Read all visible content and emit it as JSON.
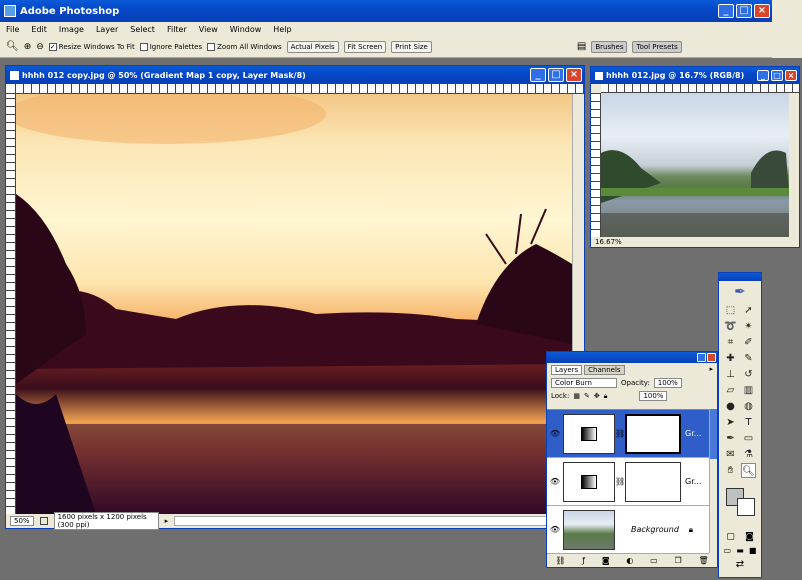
{
  "app": {
    "title": "Adobe Photoshop"
  },
  "menu": [
    "File",
    "Edit",
    "Image",
    "Layer",
    "Select",
    "Filter",
    "View",
    "Window",
    "Help"
  ],
  "options": {
    "resize_windows": "Resize Windows To Fit",
    "ignore_palettes": "Ignore Palettes",
    "zoom_all": "Zoom All Windows",
    "actual_pixels": "Actual Pixels",
    "fit_screen": "Fit Screen",
    "print_size": "Print Size",
    "well_tab1": "Brushes",
    "well_tab2": "Tool Presets"
  },
  "doc1": {
    "title": "hhhh 012 copy.jpg @ 50% (Gradient Map 1 copy, Layer Mask/8)",
    "zoom": "50%",
    "info": "1600 pixels x 1200 pixels (300 ppi)"
  },
  "doc2": {
    "title": "hhhh 012.jpg @ 16.7% (RGB/8)",
    "zoom": "16.67%"
  },
  "layers": {
    "tab1": "Layers",
    "tab2": "Channels",
    "blend_mode": "Color Burn",
    "opacity_label": "Opacity:",
    "opacity": "100%",
    "fill": "100%",
    "lock_label": "Lock:",
    "rows": [
      {
        "name": "Gr..."
      },
      {
        "name": "Gr..."
      },
      {
        "name": "Background"
      }
    ]
  },
  "colors": {
    "accent": "#0a4bd0",
    "chrome": "#ece9d8",
    "workspace": "#6f6f6f"
  }
}
